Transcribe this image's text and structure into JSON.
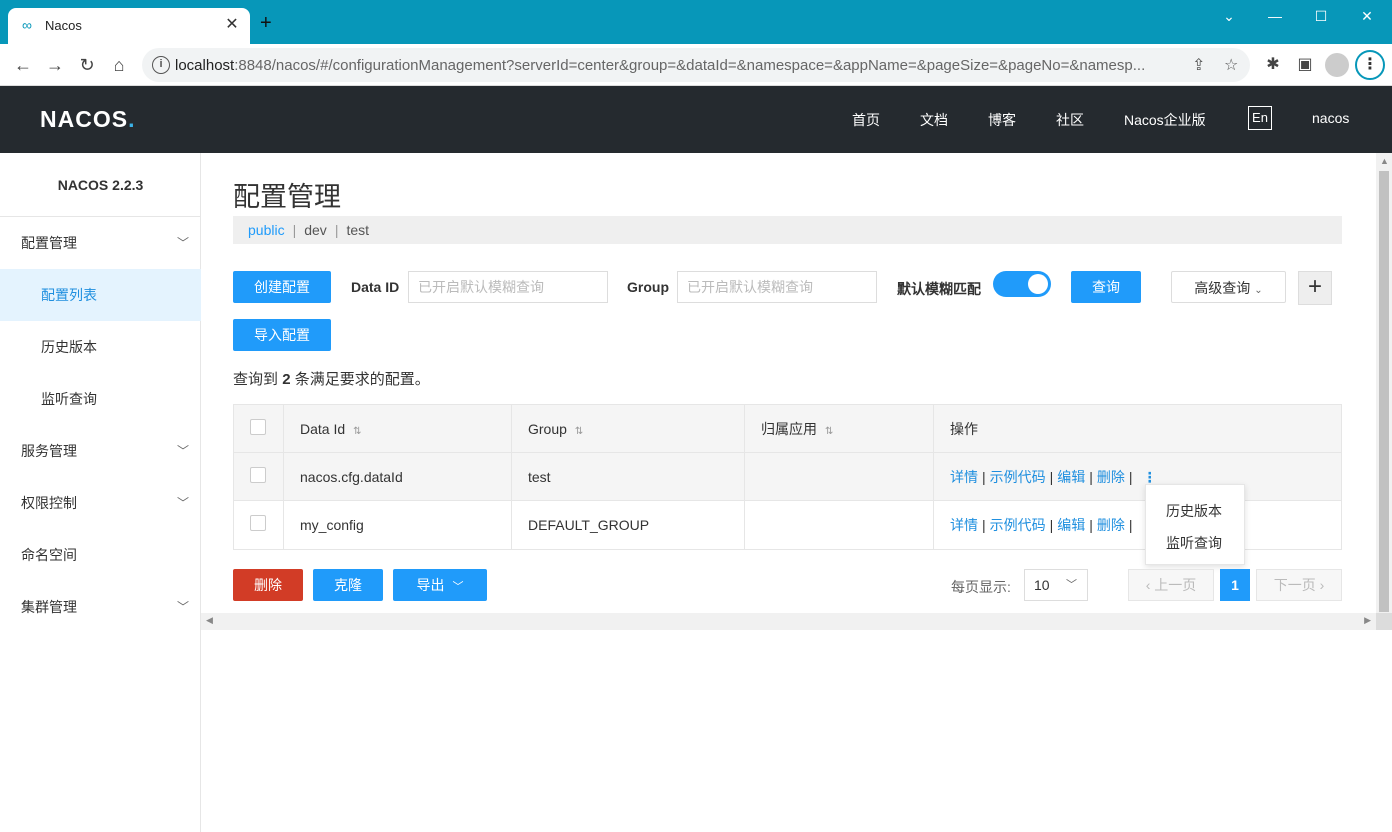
{
  "browser": {
    "tab_title": "Nacos",
    "tab_close": "✕",
    "new_tab": "+",
    "url_host": "localhost",
    "url_rest": ":8848/nacos/#/configurationManagement?serverId=center&group=&dataId=&namespace=&appName=&pageSize=&pageNo=&namesp...",
    "window_controls": {
      "minimize": "—",
      "restore": "⌄",
      "maximize": "☐",
      "close": "✕"
    }
  },
  "header": {
    "logo": "NACOS",
    "logo_dot": ".",
    "nav": [
      "首页",
      "文档",
      "博客",
      "社区",
      "Nacos企业版"
    ],
    "lang": "En",
    "user": "nacos"
  },
  "sidebar": {
    "version": "NACOS 2.2.3",
    "items": [
      {
        "label": "配置管理",
        "expandable": true
      },
      {
        "label": "配置列表",
        "active": true
      },
      {
        "label": "历史版本"
      },
      {
        "label": "监听查询"
      },
      {
        "label": "服务管理",
        "expandable": true
      },
      {
        "label": "权限控制",
        "expandable": true
      },
      {
        "label": "命名空间"
      },
      {
        "label": "集群管理",
        "expandable": true
      }
    ]
  },
  "main": {
    "title": "配置管理",
    "namespaces": [
      "public",
      "dev",
      "test"
    ],
    "selected_namespace": "public",
    "create_button": "创建配置",
    "dataid_label": "Data ID",
    "dataid_placeholder": "已开启默认模糊查询",
    "group_label": "Group",
    "group_placeholder": "已开启默认模糊查询",
    "fuzzy_label": "默认模糊匹配",
    "fuzzy_on": true,
    "query_button": "查询",
    "advanced_button": "高级查询",
    "plus_button": "+",
    "import_button": "导入配置",
    "result_prefix": "查询到",
    "result_count": "2",
    "result_suffix": "条满足要求的配置。"
  },
  "table": {
    "columns": [
      "Data Id",
      "Group",
      "归属应用",
      "操作"
    ],
    "rows": [
      {
        "data_id": "nacos.cfg.dataId",
        "group": "test",
        "app": ""
      },
      {
        "data_id": "my_config",
        "group": "DEFAULT_GROUP",
        "app": ""
      }
    ],
    "ops": [
      "详情",
      "示例代码",
      "编辑",
      "删除"
    ],
    "more": "⋮"
  },
  "dropdown": {
    "items": [
      "历史版本",
      "监听查询"
    ]
  },
  "footer": {
    "delete_button": "删除",
    "clone_button": "克隆",
    "export_button": "导出",
    "page_size_label": "每页显示:",
    "page_size": "10",
    "prev": "上一页",
    "next": "下一页",
    "current_page": "1"
  },
  "colors": {
    "primary": "#209bfa",
    "danger": "#d23c26",
    "header_bg": "#252a2f",
    "chrome": "#0797b9"
  }
}
